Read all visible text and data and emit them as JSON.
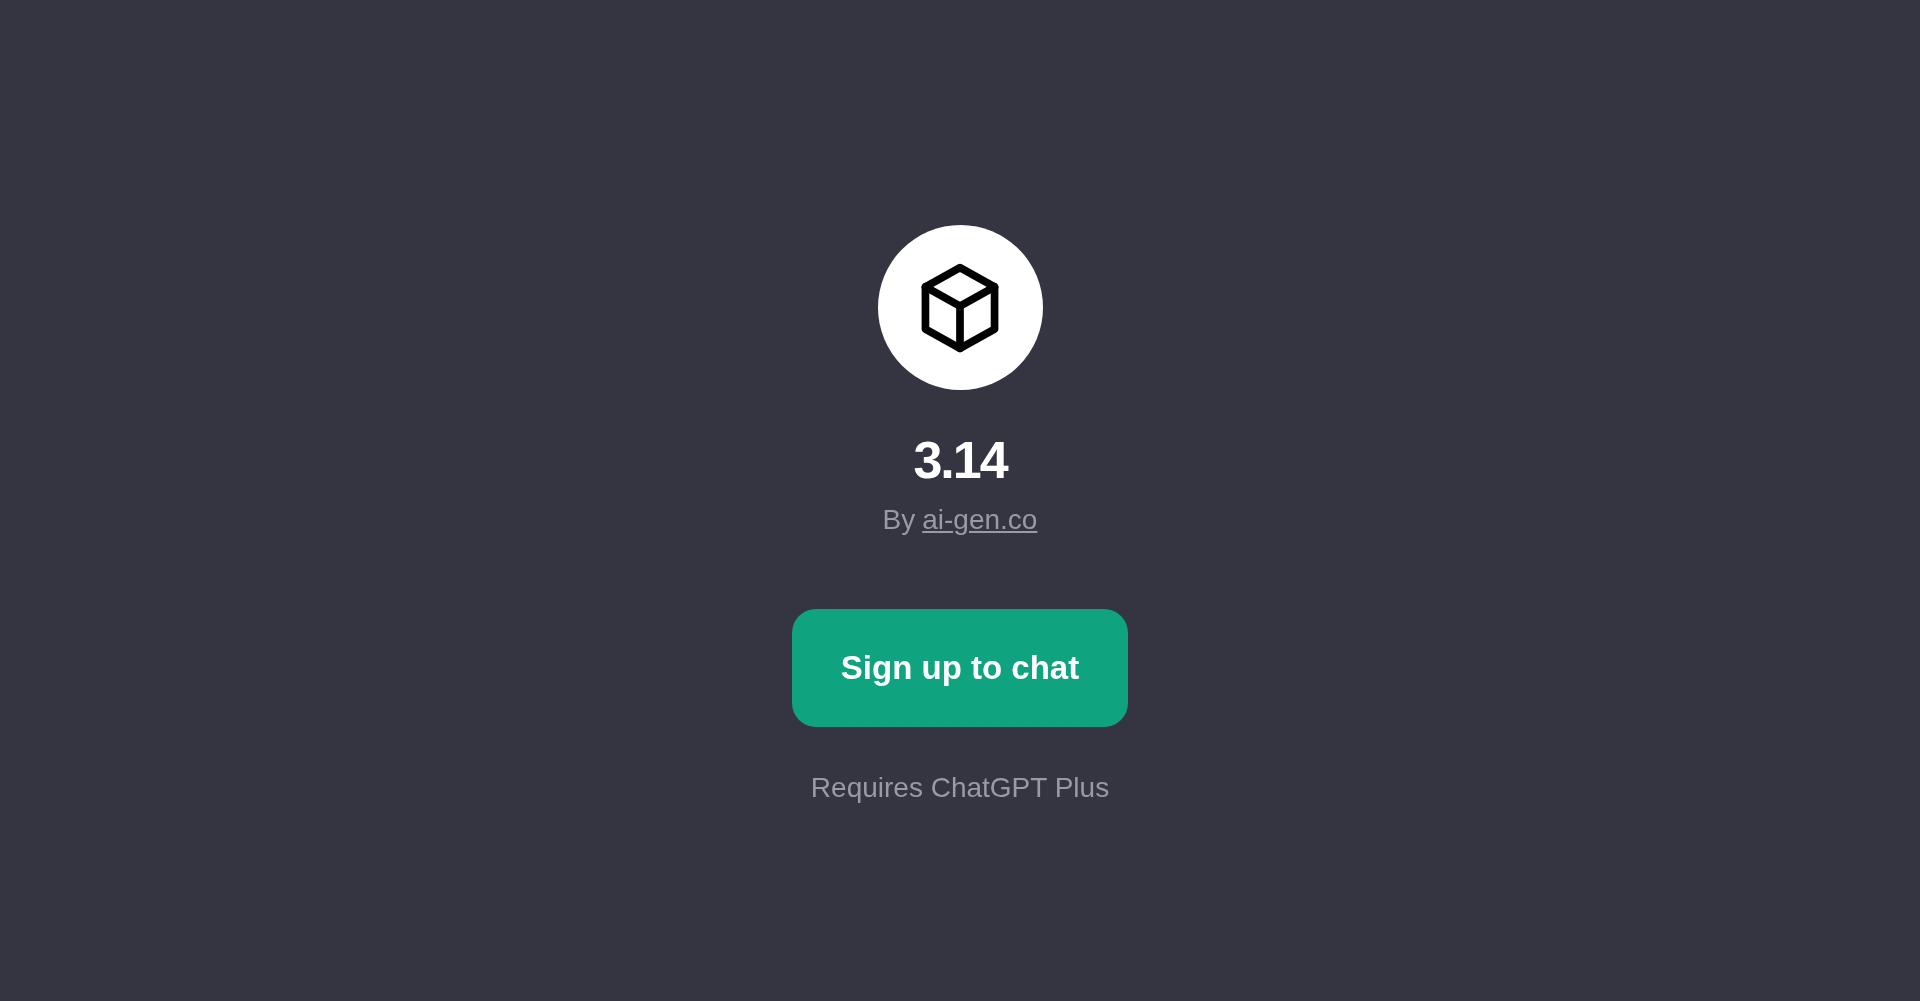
{
  "title": "3.14",
  "byline": {
    "prefix": "By",
    "author": "ai-gen.co"
  },
  "button": {
    "label": "Sign up to chat"
  },
  "note": "Requires ChatGPT Plus"
}
